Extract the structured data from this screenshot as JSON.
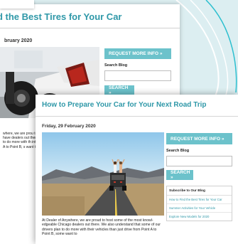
{
  "back_post": {
    "title": "nd the Best Tires for Your Car",
    "date": "bruary 2020",
    "body": "where, we are prou to have dealers out then to do more with th int A to Point B, s want to"
  },
  "front_post": {
    "title": "How to Prepare Your Car for Your Next Road Trip",
    "date": "Friday, 29 February 2020",
    "body": "At Dealer of Anywhere, we are proud to host some of the most knowl-edgeable Chicago dealers out there. We also understand that some of our drivers plan to do more with their vehicles than just drive from Point A to Point B, some want to"
  },
  "sidebar": {
    "request_label": "REQUEST MORE INFO »",
    "search_label": "Search Blog",
    "search_value": "",
    "search_button": "SEARCH »",
    "subscribe_heading": "Subscribe to Our Blog",
    "links": [
      "How to Find the Best Tires for Your Car",
      "Summer Activities for Your Vehicle",
      "Explore New Models for 2020"
    ]
  },
  "colors": {
    "accent": "#6cc2cb",
    "title": "#2f98a8",
    "background": "#dceef1"
  }
}
